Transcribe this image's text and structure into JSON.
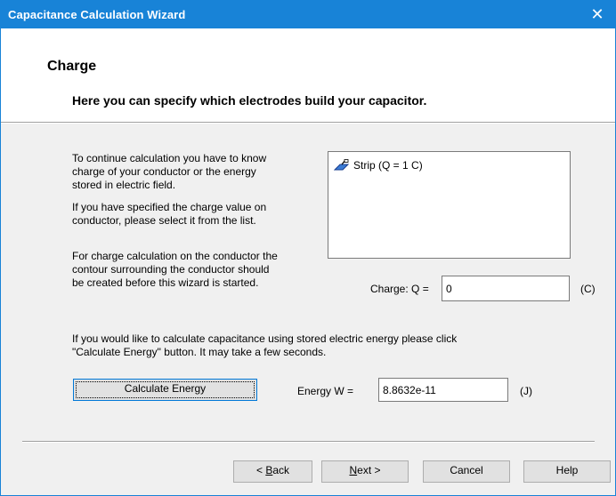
{
  "window": {
    "title": "Capacitance Calculation Wizard",
    "close_label": "✕"
  },
  "header": {
    "title": "Charge",
    "subtitle": "Here you can specify which electrodes build your capacitor."
  },
  "body": {
    "para1_line1": "To continue calculation you have to know",
    "para1_line2": "charge of your conductor or the energy",
    "para1_line3": "stored in electric field.",
    "para2_line1": "If you have specified the charge value on",
    "para2_line2": "conductor, please select it from the list.",
    "para3_line1": "For charge calculation on the conductor the",
    "para3_line2": "contour surrounding the conductor should",
    "para3_line3": "be created before this wizard is started.",
    "energy_note_line1": "If you would like to calculate capacitance using stored electric energy please click",
    "energy_note_line2": "\"Calculate Energy\" button. It may take a few seconds."
  },
  "conductor_list": {
    "items": [
      {
        "label": "Strip (Q = 1 C)",
        "icon": "strip-conductor-icon"
      }
    ]
  },
  "charge": {
    "label": "Charge:  Q =",
    "value": "0",
    "unit": "(C)"
  },
  "energy": {
    "button_label": "Calculate Energy",
    "label": "Energy  W =",
    "value": "8.8632e-11",
    "unit": "(J)"
  },
  "footer": {
    "back_prefix": "< ",
    "back_key": "B",
    "back_rest": "ack",
    "next_key": "N",
    "next_rest": "ext >",
    "cancel_label": "Cancel",
    "help_label": "Help"
  },
  "colors": {
    "titlebar": "#1883d7",
    "dialog_bg": "#f0f0f0",
    "header_bg": "#ffffff"
  }
}
